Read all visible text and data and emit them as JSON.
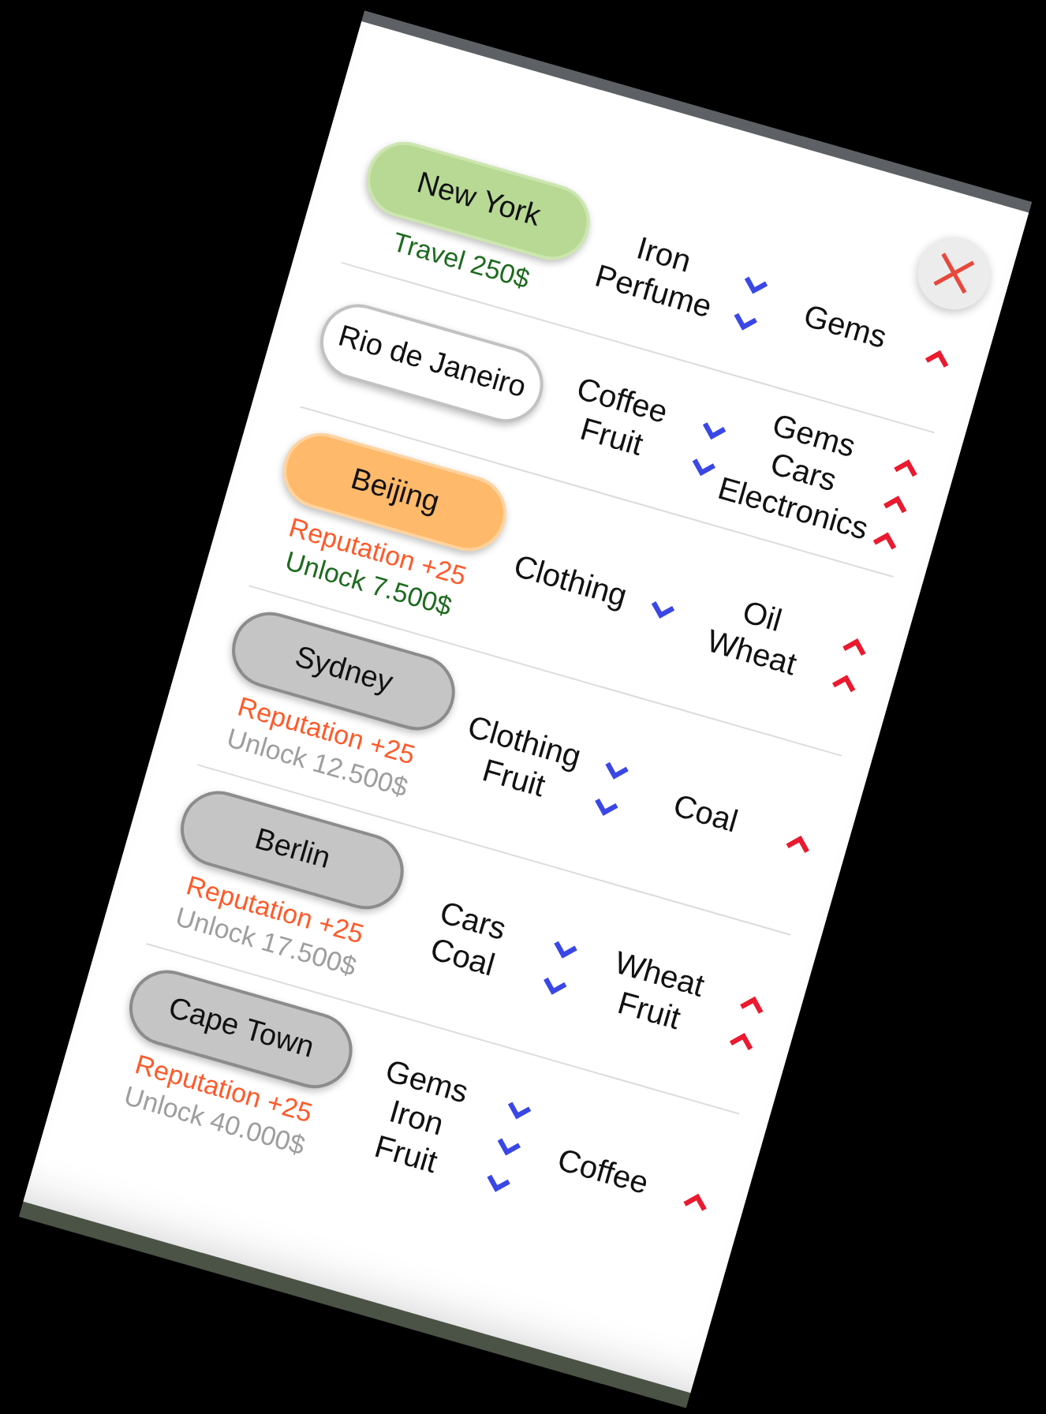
{
  "cities": [
    {
      "name": "New York",
      "kind": "current",
      "notes": [
        {
          "kind": "travel",
          "text": "Travel 250$"
        }
      ],
      "goods_down": [
        "Iron",
        "Perfume"
      ],
      "goods_up": [
        "Gems"
      ]
    },
    {
      "name": "Rio de Janeiro",
      "kind": "available",
      "goods_down": [
        "Coffee",
        "Fruit"
      ],
      "goods_up": [
        "Gems",
        "Cars",
        "Electronics"
      ]
    },
    {
      "name": "Beijing",
      "kind": "unlockable",
      "notes": [
        {
          "kind": "reputation",
          "text": "Reputation +25"
        },
        {
          "kind": "unlock",
          "text": "Unlock 7.500$"
        }
      ],
      "goods_down": [
        "Clothing"
      ],
      "goods_up": [
        "Oil",
        "Wheat"
      ]
    },
    {
      "name": "Sydney",
      "kind": "locked",
      "notes": [
        {
          "kind": "reputation",
          "text": "Reputation +25"
        },
        {
          "kind": "unlock",
          "text": "Unlock 12.500$"
        }
      ],
      "goods_down": [
        "Clothing",
        "Fruit"
      ],
      "goods_up": [
        "Coal"
      ]
    },
    {
      "name": "Berlin",
      "kind": "locked",
      "notes": [
        {
          "kind": "reputation",
          "text": "Reputation +25"
        },
        {
          "kind": "unlock",
          "text": "Unlock 17.500$"
        }
      ],
      "goods_down": [
        "Cars",
        "Coal"
      ],
      "goods_up": [
        "Wheat",
        "Fruit"
      ]
    },
    {
      "name": "Cape Town",
      "kind": "locked",
      "notes": [
        {
          "kind": "reputation",
          "text": "Reputation +25"
        },
        {
          "kind": "unlock",
          "text": "Unlock 40.000$"
        }
      ],
      "goods_down": [
        "Gems",
        "Iron",
        "Fruit"
      ],
      "goods_up": [
        "Coffee"
      ]
    }
  ]
}
